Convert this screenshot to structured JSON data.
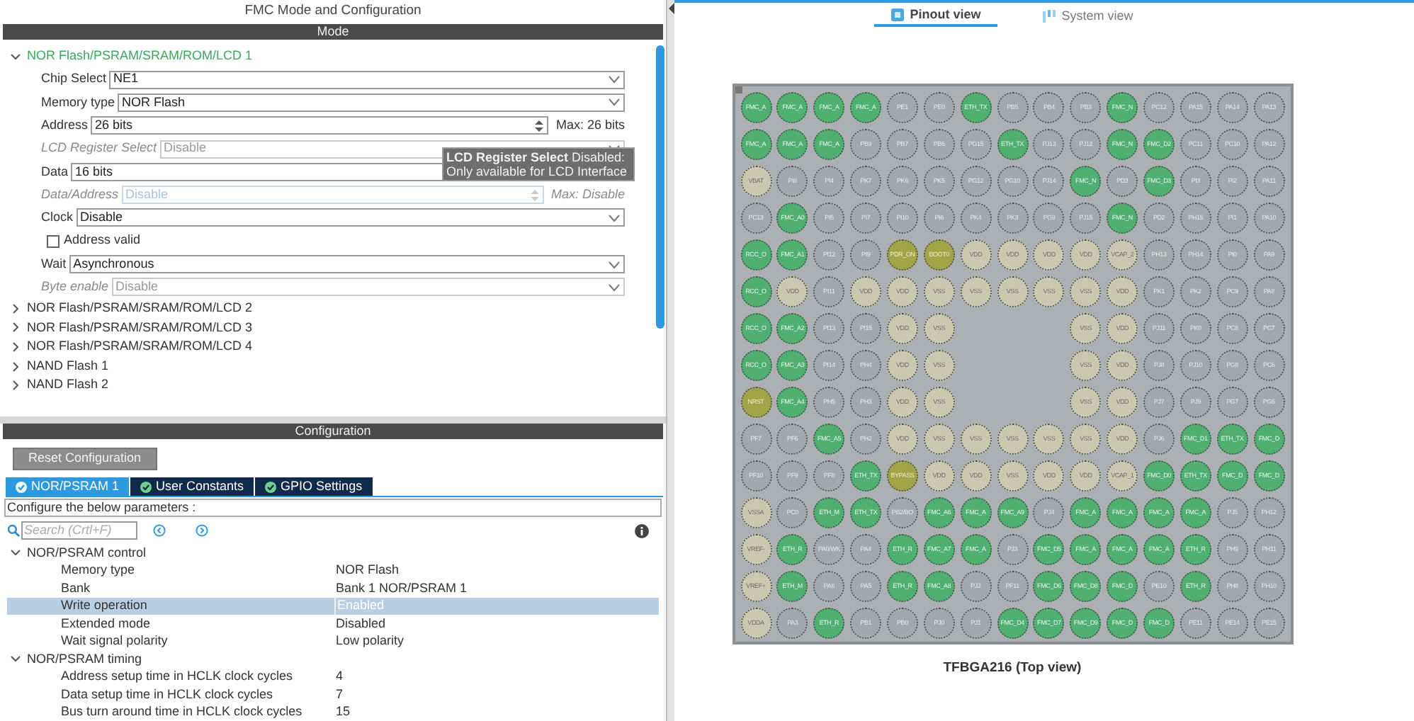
{
  "mode": {
    "title": "FMC Mode and Configuration",
    "header": "Mode",
    "sections": [
      {
        "label": "NOR Flash/PSRAM/SRAM/ROM/LCD 1",
        "expanded": true,
        "fields": [
          {
            "kind": "select",
            "label": "Chip Select",
            "value": "NE1",
            "disabled": false
          },
          {
            "kind": "select",
            "label": "Memory type",
            "value": "NOR Flash",
            "disabled": false
          },
          {
            "kind": "spin",
            "label": "Address",
            "value": "26 bits",
            "max": "Max: 26 bits",
            "disabled": false
          },
          {
            "kind": "select",
            "label": "LCD Register Select",
            "value": "Disable",
            "disabled": true
          },
          {
            "kind": "select",
            "label": "Data",
            "value": "16 bits",
            "disabled": false
          },
          {
            "kind": "spin",
            "label": "Data/Address",
            "value": "Disable",
            "max": "Max: Disable",
            "disabled": true
          },
          {
            "kind": "select",
            "label": "Clock",
            "value": "Disable",
            "disabled": false
          },
          {
            "kind": "checkbox",
            "label": "Address valid",
            "checked": false
          },
          {
            "kind": "select",
            "label": "Wait",
            "value": "Asynchronous",
            "disabled": false
          },
          {
            "kind": "select",
            "label": "Byte enable",
            "value": "Disable",
            "disabled": true
          }
        ]
      },
      {
        "label": "NOR Flash/PSRAM/SRAM/ROM/LCD 2",
        "expanded": false
      },
      {
        "label": "NOR Flash/PSRAM/SRAM/ROM/LCD 3",
        "expanded": false
      },
      {
        "label": "NOR Flash/PSRAM/SRAM/ROM/LCD 4",
        "expanded": false
      },
      {
        "label": "NAND Flash 1",
        "expanded": false
      },
      {
        "label": "NAND Flash 2",
        "expanded": false
      }
    ],
    "tooltip": "**LCD Register Select** Disabled: Only available for LCD Interface"
  },
  "configuration": {
    "header": "Configuration",
    "reset_button": "Reset Configuration",
    "tabs": [
      {
        "label": "NOR/PSRAM 1",
        "selected": true
      },
      {
        "label": "User Constants",
        "selected": false
      },
      {
        "label": "GPIO Settings",
        "selected": false
      }
    ],
    "description": "Configure the below parameters :",
    "search": {
      "placeholder": "Search (Crtl+F)"
    },
    "groups": [
      {
        "label": "NOR/PSRAM control",
        "expanded": true,
        "params": [
          {
            "name": "Memory type",
            "value": "NOR Flash",
            "selected": false
          },
          {
            "name": "Bank",
            "value": "Bank 1 NOR/PSRAM 1",
            "selected": false
          },
          {
            "name": "Write operation",
            "value": "Enabled",
            "selected": true
          },
          {
            "name": "Extended mode",
            "value": "Disabled",
            "selected": false
          },
          {
            "name": "Wait signal polarity",
            "value": "Low polarity",
            "selected": false
          }
        ]
      },
      {
        "label": "NOR/PSRAM timing",
        "expanded": true,
        "params": [
          {
            "name": "Address setup time in HCLK clock cycles",
            "value": "4",
            "selected": false
          },
          {
            "name": "Data setup time in HCLK clock cycles",
            "value": "7",
            "selected": false
          },
          {
            "name": "Bus turn around time in HCLK clock cycles",
            "value": "15",
            "selected": false
          }
        ]
      }
    ]
  },
  "view_tabs": [
    {
      "label": "Pinout view",
      "selected": true
    },
    {
      "label": "System view",
      "selected": false
    }
  ],
  "chip": {
    "caption": "TFBGA216 (Top view)",
    "rows": [
      [
        {
          "label": "FMC_A",
          "kind": "assigned"
        },
        {
          "label": "FMC_A",
          "kind": "assigned"
        },
        {
          "label": "FMC_A",
          "kind": "assigned"
        },
        {
          "label": "FMC_A",
          "kind": "assigned"
        },
        {
          "label": "PE1",
          "kind": "free"
        },
        {
          "label": "PE0",
          "kind": "free"
        },
        {
          "label": "ETH_TX",
          "kind": "assigned"
        },
        {
          "label": "PB5",
          "kind": "free"
        },
        {
          "label": "PB4",
          "kind": "free"
        },
        {
          "label": "PB3",
          "kind": "free"
        },
        {
          "label": "FMC_N",
          "kind": "assigned"
        },
        {
          "label": "PC12",
          "kind": "free"
        },
        {
          "label": "PA15",
          "kind": "free"
        },
        {
          "label": "PA14",
          "kind": "free"
        },
        {
          "label": "PA13",
          "kind": "free"
        }
      ],
      [
        {
          "label": "FMC_A",
          "kind": "assigned"
        },
        {
          "label": "FMC_A",
          "kind": "assigned"
        },
        {
          "label": "FMC_A",
          "kind": "assigned"
        },
        {
          "label": "PB9",
          "kind": "free"
        },
        {
          "label": "PB7",
          "kind": "free"
        },
        {
          "label": "PB6",
          "kind": "free"
        },
        {
          "label": "PG15",
          "kind": "free"
        },
        {
          "label": "ETH_TX",
          "kind": "assigned"
        },
        {
          "label": "PJ13",
          "kind": "free"
        },
        {
          "label": "PJ12",
          "kind": "free"
        },
        {
          "label": "FMC_N",
          "kind": "assigned"
        },
        {
          "label": "FMC_D2",
          "kind": "assigned"
        },
        {
          "label": "PC11",
          "kind": "free"
        },
        {
          "label": "PC10",
          "kind": "free"
        },
        {
          "label": "PA12",
          "kind": "free"
        }
      ],
      [
        {
          "label": "VBAT",
          "kind": "power"
        },
        {
          "label": "PI8",
          "kind": "free"
        },
        {
          "label": "PI4",
          "kind": "free"
        },
        {
          "label": "PK7",
          "kind": "free"
        },
        {
          "label": "PK6",
          "kind": "free"
        },
        {
          "label": "PK5",
          "kind": "free"
        },
        {
          "label": "PG12",
          "kind": "free"
        },
        {
          "label": "PG10",
          "kind": "free"
        },
        {
          "label": "PJ14",
          "kind": "free"
        },
        {
          "label": "FMC_N",
          "kind": "assigned"
        },
        {
          "label": "PD3",
          "kind": "free"
        },
        {
          "label": "FMC_D3",
          "kind": "assigned"
        },
        {
          "label": "PI3",
          "kind": "free"
        },
        {
          "label": "PI2",
          "kind": "free"
        },
        {
          "label": "PA11",
          "kind": "free"
        }
      ],
      [
        {
          "label": "PC13",
          "kind": "free"
        },
        {
          "label": "FMC_A0",
          "kind": "assigned"
        },
        {
          "label": "PI5",
          "kind": "free"
        },
        {
          "label": "PI7",
          "kind": "free"
        },
        {
          "label": "PI10",
          "kind": "free"
        },
        {
          "label": "PI6",
          "kind": "free"
        },
        {
          "label": "PK4",
          "kind": "free"
        },
        {
          "label": "PK3",
          "kind": "free"
        },
        {
          "label": "PG9",
          "kind": "free"
        },
        {
          "label": "PJ15",
          "kind": "free"
        },
        {
          "label": "FMC_N",
          "kind": "assigned"
        },
        {
          "label": "PD2",
          "kind": "free"
        },
        {
          "label": "PH15",
          "kind": "free"
        },
        {
          "label": "PI1",
          "kind": "free"
        },
        {
          "label": "PA10",
          "kind": "free"
        }
      ],
      [
        {
          "label": "RCC_O",
          "kind": "assigned"
        },
        {
          "label": "FMC_A1",
          "kind": "assigned"
        },
        {
          "label": "PI12",
          "kind": "free"
        },
        {
          "label": "PI9",
          "kind": "free"
        },
        {
          "label": "PDR_ON",
          "kind": "boot"
        },
        {
          "label": "BOOT0",
          "kind": "boot"
        },
        {
          "label": "VDD",
          "kind": "power"
        },
        {
          "label": "VDD",
          "kind": "power"
        },
        {
          "label": "VDD",
          "kind": "power"
        },
        {
          "label": "VDD",
          "kind": "power"
        },
        {
          "label": "VCAP_2",
          "kind": "power"
        },
        {
          "label": "PH13",
          "kind": "free"
        },
        {
          "label": "PH14",
          "kind": "free"
        },
        {
          "label": "PI0",
          "kind": "free"
        },
        {
          "label": "PA9",
          "kind": "free"
        }
      ],
      [
        {
          "label": "RCC_O",
          "kind": "assigned"
        },
        {
          "label": "VDD",
          "kind": "power"
        },
        {
          "label": "PI11",
          "kind": "free"
        },
        {
          "label": "VDD",
          "kind": "power"
        },
        {
          "label": "VDD",
          "kind": "power"
        },
        {
          "label": "VSS",
          "kind": "power"
        },
        {
          "label": "VSS",
          "kind": "power"
        },
        {
          "label": "VSS",
          "kind": "power"
        },
        {
          "label": "VSS",
          "kind": "power"
        },
        {
          "label": "VSS",
          "kind": "power"
        },
        {
          "label": "VDD",
          "kind": "power"
        },
        {
          "label": "PK1",
          "kind": "free"
        },
        {
          "label": "PK2",
          "kind": "free"
        },
        {
          "label": "PC9",
          "kind": "free"
        },
        {
          "label": "PA8",
          "kind": "free"
        }
      ],
      [
        {
          "label": "RCC_O",
          "kind": "assigned"
        },
        {
          "label": "FMC_A2",
          "kind": "assigned"
        },
        {
          "label": "PI13",
          "kind": "free"
        },
        {
          "label": "PI15",
          "kind": "free"
        },
        {
          "label": "VDD",
          "kind": "power"
        },
        {
          "label": "VSS",
          "kind": "power"
        },
        {
          "kind": "gap"
        },
        {
          "kind": "gap"
        },
        {
          "kind": "gap"
        },
        {
          "label": "VSS",
          "kind": "power"
        },
        {
          "label": "VDD",
          "kind": "power"
        },
        {
          "label": "PJ11",
          "kind": "free"
        },
        {
          "label": "PK0",
          "kind": "free"
        },
        {
          "label": "PC8",
          "kind": "free"
        },
        {
          "label": "PC7",
          "kind": "free"
        }
      ],
      [
        {
          "label": "RCC_O",
          "kind": "assigned"
        },
        {
          "label": "FMC_A3",
          "kind": "assigned"
        },
        {
          "label": "PI14",
          "kind": "free"
        },
        {
          "label": "PH4",
          "kind": "free"
        },
        {
          "label": "VDD",
          "kind": "power"
        },
        {
          "label": "VSS",
          "kind": "power"
        },
        {
          "kind": "gap"
        },
        {
          "kind": "gap"
        },
        {
          "kind": "gap"
        },
        {
          "label": "VSS",
          "kind": "power"
        },
        {
          "label": "VDD",
          "kind": "power"
        },
        {
          "label": "PJ8",
          "kind": "free"
        },
        {
          "label": "PJ10",
          "kind": "free"
        },
        {
          "label": "PG8",
          "kind": "free"
        },
        {
          "label": "PC6",
          "kind": "free"
        }
      ],
      [
        {
          "label": "NRST",
          "kind": "boot"
        },
        {
          "label": "FMC_A4",
          "kind": "assigned"
        },
        {
          "label": "PH5",
          "kind": "free"
        },
        {
          "label": "PH3",
          "kind": "free"
        },
        {
          "label": "VDD",
          "kind": "power"
        },
        {
          "label": "VSS",
          "kind": "power"
        },
        {
          "kind": "gap"
        },
        {
          "kind": "gap"
        },
        {
          "kind": "gap"
        },
        {
          "label": "VSS",
          "kind": "power"
        },
        {
          "label": "VDD",
          "kind": "power"
        },
        {
          "label": "PJ7",
          "kind": "free"
        },
        {
          "label": "PJ9",
          "kind": "free"
        },
        {
          "label": "PG7",
          "kind": "free"
        },
        {
          "label": "PG6",
          "kind": "free"
        }
      ],
      [
        {
          "label": "PF7",
          "kind": "free"
        },
        {
          "label": "PF6",
          "kind": "free"
        },
        {
          "label": "FMC_A5",
          "kind": "assigned"
        },
        {
          "label": "PH2",
          "kind": "free"
        },
        {
          "label": "VDD",
          "kind": "power"
        },
        {
          "label": "VSS",
          "kind": "power"
        },
        {
          "label": "VSS",
          "kind": "power"
        },
        {
          "label": "VSS",
          "kind": "power"
        },
        {
          "label": "VSS",
          "kind": "power"
        },
        {
          "label": "VSS",
          "kind": "power"
        },
        {
          "label": "VDD",
          "kind": "power"
        },
        {
          "label": "PJ6",
          "kind": "free"
        },
        {
          "label": "FMC_D1",
          "kind": "assigned"
        },
        {
          "label": "ETH_TX",
          "kind": "assigned"
        },
        {
          "label": "FMC_D",
          "kind": "assigned"
        }
      ],
      [
        {
          "label": "PF10",
          "kind": "free"
        },
        {
          "label": "PF9",
          "kind": "free"
        },
        {
          "label": "PF8",
          "kind": "free"
        },
        {
          "label": "ETH_TX",
          "kind": "assigned"
        },
        {
          "label": "BYPASS",
          "kind": "boot"
        },
        {
          "label": "VDD",
          "kind": "power"
        },
        {
          "label": "VDD",
          "kind": "power"
        },
        {
          "label": "VSS",
          "kind": "power"
        },
        {
          "label": "VDD",
          "kind": "power"
        },
        {
          "label": "VDD",
          "kind": "power"
        },
        {
          "label": "VCAP_1",
          "kind": "power"
        },
        {
          "label": "FMC_D0",
          "kind": "assigned"
        },
        {
          "label": "ETH_TX",
          "kind": "assigned"
        },
        {
          "label": "FMC_D",
          "kind": "assigned"
        },
        {
          "label": "FMC_D",
          "kind": "assigned"
        }
      ],
      [
        {
          "label": "VSSA",
          "kind": "power"
        },
        {
          "label": "PC0",
          "kind": "free"
        },
        {
          "label": "ETH_M",
          "kind": "assigned"
        },
        {
          "label": "ETH_TX",
          "kind": "assigned"
        },
        {
          "label": "PB2/BO",
          "kind": "free"
        },
        {
          "label": "FMC_A6",
          "kind": "assigned"
        },
        {
          "label": "FMC_A",
          "kind": "assigned"
        },
        {
          "label": "FMC_A9",
          "kind": "assigned"
        },
        {
          "label": "PJ4",
          "kind": "free"
        },
        {
          "label": "FMC_A",
          "kind": "assigned"
        },
        {
          "label": "FMC_A",
          "kind": "assigned"
        },
        {
          "label": "FMC_A",
          "kind": "assigned"
        },
        {
          "label": "FMC_A",
          "kind": "assigned"
        },
        {
          "label": "PJ5",
          "kind": "free"
        },
        {
          "label": "PH12",
          "kind": "free"
        }
      ],
      [
        {
          "label": "VREF-",
          "kind": "power"
        },
        {
          "label": "ETH_R",
          "kind": "assigned"
        },
        {
          "label": "PA0/WK",
          "kind": "free"
        },
        {
          "label": "PA4",
          "kind": "free"
        },
        {
          "label": "ETH_R",
          "kind": "assigned"
        },
        {
          "label": "FMC_A7",
          "kind": "assigned"
        },
        {
          "label": "FMC_A",
          "kind": "assigned"
        },
        {
          "label": "PJ3",
          "kind": "free"
        },
        {
          "label": "FMC_D5",
          "kind": "assigned"
        },
        {
          "label": "FMC_A",
          "kind": "assigned"
        },
        {
          "label": "FMC_A",
          "kind": "assigned"
        },
        {
          "label": "FMC_A",
          "kind": "assigned"
        },
        {
          "label": "ETH_R",
          "kind": "assigned"
        },
        {
          "label": "PH9",
          "kind": "free"
        },
        {
          "label": "PH11",
          "kind": "free"
        }
      ],
      [
        {
          "label": "VREF+",
          "kind": "power"
        },
        {
          "label": "ETH_M",
          "kind": "assigned"
        },
        {
          "label": "PA6",
          "kind": "free"
        },
        {
          "label": "PA5",
          "kind": "free"
        },
        {
          "label": "ETH_R",
          "kind": "assigned"
        },
        {
          "label": "FMC_A8",
          "kind": "assigned"
        },
        {
          "label": "PJ2",
          "kind": "free"
        },
        {
          "label": "PF11",
          "kind": "free"
        },
        {
          "label": "FMC_D6",
          "kind": "assigned"
        },
        {
          "label": "FMC_D8",
          "kind": "assigned"
        },
        {
          "label": "FMC_D",
          "kind": "assigned"
        },
        {
          "label": "PE10",
          "kind": "free"
        },
        {
          "label": "ETH_R",
          "kind": "assigned"
        },
        {
          "label": "PH8",
          "kind": "free"
        },
        {
          "label": "PH10",
          "kind": "free"
        }
      ],
      [
        {
          "label": "VDDA",
          "kind": "power"
        },
        {
          "label": "PA3",
          "kind": "free"
        },
        {
          "label": "ETH_R",
          "kind": "assigned"
        },
        {
          "label": "PB1",
          "kind": "free"
        },
        {
          "label": "PB0",
          "kind": "free"
        },
        {
          "label": "PJ0",
          "kind": "free"
        },
        {
          "label": "PJ1",
          "kind": "free"
        },
        {
          "label": "FMC_D4",
          "kind": "assigned"
        },
        {
          "label": "FMC_D7",
          "kind": "assigned"
        },
        {
          "label": "FMC_D9",
          "kind": "assigned"
        },
        {
          "label": "FMC_D",
          "kind": "assigned"
        },
        {
          "label": "FMC_D",
          "kind": "assigned"
        },
        {
          "label": "PE11",
          "kind": "free"
        },
        {
          "label": "PE14",
          "kind": "free"
        },
        {
          "label": "PE15",
          "kind": "free"
        }
      ]
    ]
  }
}
